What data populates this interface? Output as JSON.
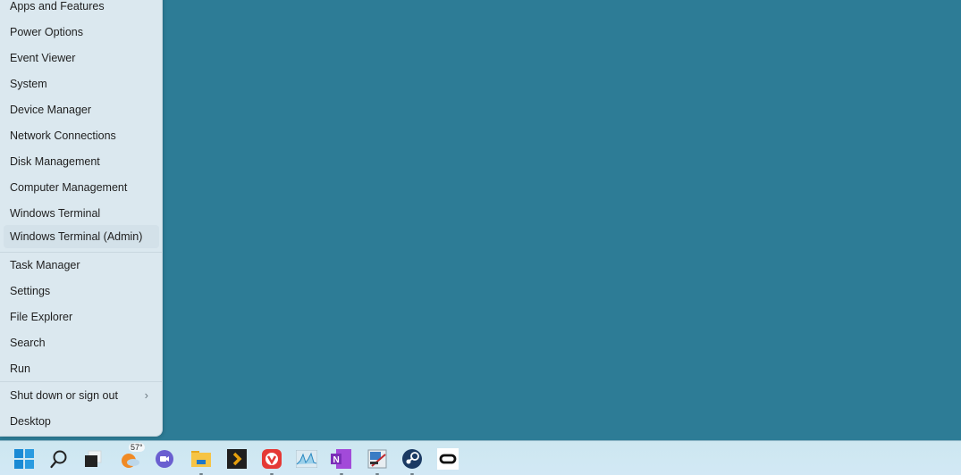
{
  "desktop": {
    "background_color": "#2d7c96"
  },
  "context_menu": {
    "items": [
      {
        "label": "Apps and Features"
      },
      {
        "label": "Power Options"
      },
      {
        "label": "Event Viewer"
      },
      {
        "label": "System"
      },
      {
        "label": "Device Manager"
      },
      {
        "label": "Network Connections"
      },
      {
        "label": "Disk Management"
      },
      {
        "label": "Computer Management"
      },
      {
        "label": "Windows Terminal"
      },
      {
        "label": "Windows Terminal (Admin)",
        "hovered": true
      },
      {
        "label": "Task Manager"
      },
      {
        "label": "Settings"
      },
      {
        "label": "File Explorer"
      },
      {
        "label": "Search"
      },
      {
        "label": "Run"
      },
      {
        "label": "Shut down or sign out",
        "has_submenu": true
      },
      {
        "label": "Desktop"
      }
    ],
    "submenu_chevron": "›"
  },
  "taskbar": {
    "icons": [
      {
        "name": "start-icon",
        "running": false
      },
      {
        "name": "search-icon",
        "running": false
      },
      {
        "name": "task-view-icon",
        "running": false
      },
      {
        "name": "weather-icon",
        "badge": "57°",
        "running": false
      },
      {
        "name": "teams-chat-icon",
        "running": false
      },
      {
        "name": "file-explorer-icon",
        "running": true
      },
      {
        "name": "plex-icon",
        "running": false
      },
      {
        "name": "vivaldi-icon",
        "running": true
      },
      {
        "name": "resource-monitor-icon",
        "running": false
      },
      {
        "name": "onenote-icon",
        "running": true
      },
      {
        "name": "paint-tool-icon",
        "running": true
      },
      {
        "name": "steam-icon",
        "running": true
      },
      {
        "name": "oculus-icon",
        "running": false
      }
    ]
  }
}
